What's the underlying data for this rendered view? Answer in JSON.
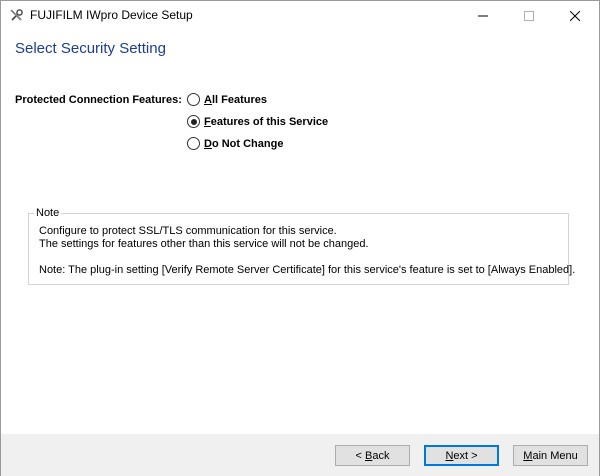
{
  "window": {
    "title": "FUJIFILM IWpro Device Setup",
    "icon": "wrench-screwdriver-icon"
  },
  "page": {
    "title": "Select Security Setting"
  },
  "protected_connection": {
    "label": "Protected Connection Features:",
    "options": [
      {
        "mnemonic": "A",
        "rest": "ll Features",
        "selected": false
      },
      {
        "mnemonic": "F",
        "rest": "eatures of this Service",
        "selected": true
      },
      {
        "mnemonic": "D",
        "rest": "o Not Change",
        "selected": false
      }
    ]
  },
  "note": {
    "legend": "Note",
    "line1": "Configure to protect SSL/TLS communication for this service.",
    "line2": "The settings for features other than this service will not be changed.",
    "line3": "Note: The plug-in setting [Verify Remote Server Certificate] for this service's feature is set to [Always Enabled]."
  },
  "buttons": {
    "back_prefix": "< ",
    "back_mnemonic": "B",
    "back_rest": "ack",
    "next_mnemonic": "N",
    "next_rest": "ext >",
    "main_mnemonic": "M",
    "main_rest": "ain Menu"
  }
}
